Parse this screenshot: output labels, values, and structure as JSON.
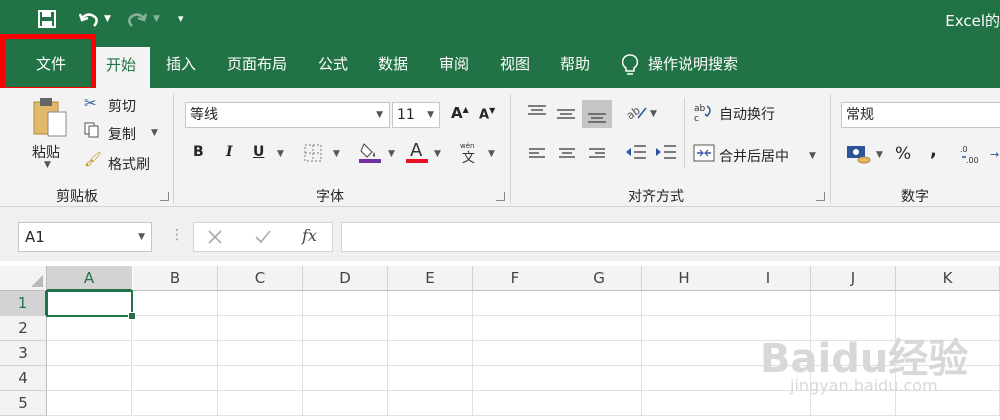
{
  "quick_access": {
    "save_icon": "save-icon",
    "undo_icon": "undo-icon",
    "redo_icon": "redo-icon",
    "customize_icon": "customize-icon"
  },
  "app_title": "Excel的",
  "tabs": [
    "文件",
    "开始",
    "插入",
    "页面布局",
    "公式",
    "数据",
    "审阅",
    "视图",
    "帮助"
  ],
  "tell_me": "操作说明搜索",
  "clipboard": {
    "paste": "粘贴",
    "cut": "剪切",
    "copy": "复制",
    "format_painter": "格式刷",
    "group": "剪贴板"
  },
  "font": {
    "name": "等线",
    "size": "11",
    "group": "字体",
    "bold": "B",
    "italic": "I",
    "underline": "U"
  },
  "alignment": {
    "wrap": "自动换行",
    "merge": "合并后居中",
    "group": "对齐方式"
  },
  "number": {
    "format": "常规",
    "group": "数字",
    "percent": "%",
    "comma": ","
  },
  "formula_bar": {
    "name_box": "A1",
    "fx": "fx",
    "formula": ""
  },
  "columns": [
    "A",
    "B",
    "C",
    "D",
    "E",
    "F",
    "G",
    "H",
    "I",
    "J",
    "K"
  ],
  "rows": [
    "1",
    "2",
    "3",
    "4",
    "5"
  ],
  "watermark": {
    "brand": "Baidu经验",
    "url": "jingyan.baidu.com"
  },
  "colors": {
    "brand": "#217346",
    "highlight": "#ff0000",
    "font_color": "#e81123",
    "fill_color": "#7030a0"
  }
}
